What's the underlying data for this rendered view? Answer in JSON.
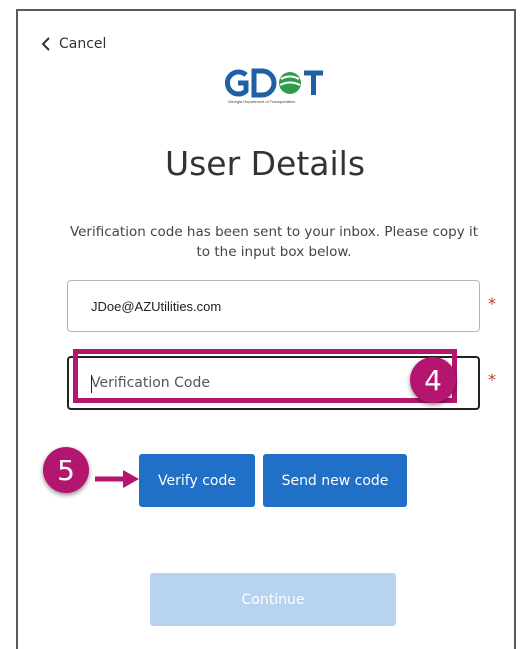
{
  "header": {
    "cancel_label": "Cancel"
  },
  "logo": {
    "text": "GDOT",
    "subtitle": "Georgia Department of Transportation"
  },
  "page": {
    "title": "User Details",
    "description": "Verification code has been sent to your inbox. Please copy it to the input box below."
  },
  "form": {
    "email_value": "JDoe@AZUtilities.com",
    "code_placeholder": "Verification Code",
    "required_marker": "*"
  },
  "buttons": {
    "verify": "Verify code",
    "send_new": "Send new code",
    "continue": "Continue"
  },
  "annotations": {
    "step_4": "4",
    "step_5": "5",
    "highlight_color": "#b4156f"
  },
  "colors": {
    "primary_button": "#2170c8",
    "disabled_button": "#b8d3f0",
    "logo_blue": "#1f5fa5",
    "logo_green": "#2e9c4a",
    "required": "#c0392b"
  }
}
